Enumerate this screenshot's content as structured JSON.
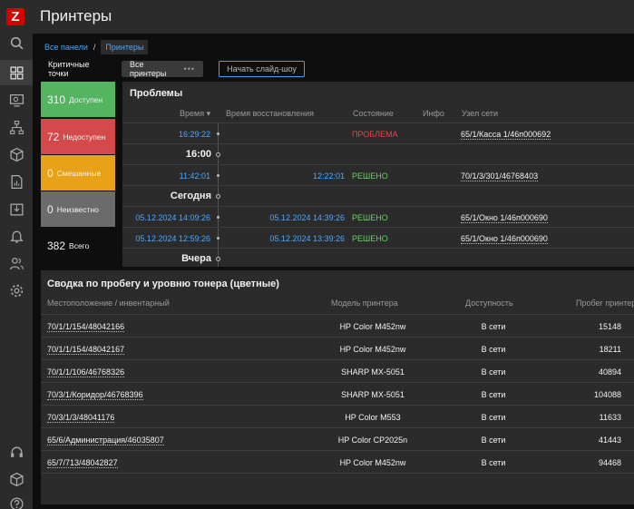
{
  "app": {
    "logo_letter": "Z"
  },
  "header": {
    "title": "Принтеры"
  },
  "breadcrumb": {
    "all": "Все панели",
    "separator": "/",
    "current": "Принтеры"
  },
  "tabs": {
    "critical": "Критичные точки",
    "all": "Все принтеры",
    "all_more": "•••"
  },
  "slideshow": {
    "label": "Начать слайд-шоу"
  },
  "sidebar": {
    "icons": [
      "search-icon",
      "dashboard-icon",
      "monitoring-icon",
      "network-icon",
      "inventory-icon",
      "reports-icon",
      "data-collection-icon",
      "alerts-icon",
      "users-icon",
      "settings-icon",
      "support-icon",
      "integrations-icon",
      "help-icon"
    ]
  },
  "status": {
    "available": {
      "count": "310",
      "label": "Доступен",
      "color": "#53b560"
    },
    "unavailable": {
      "count": "72",
      "label": "Недоступен",
      "color": "#d44a4a"
    },
    "mixed": {
      "count": "0",
      "label": "Смешанные",
      "color": "#e8a219"
    },
    "unknown": {
      "count": "0",
      "label": "Неизвестно",
      "color": "#6b6b6b"
    },
    "total": {
      "count": "382",
      "label": "Всего"
    }
  },
  "problems": {
    "title": "Проблемы",
    "columns": {
      "time": "Время ▾",
      "recovery": "Время восстановления",
      "state": "Состояние",
      "info": "Инфо",
      "host": "Узел сети"
    },
    "rows": [
      {
        "type": "event",
        "time": "16:29:22",
        "recovery": "",
        "state": "ПРОБЛЕМА",
        "host": "65/1/Касса 1/46п000692"
      },
      {
        "type": "divider",
        "label": "16:00"
      },
      {
        "type": "event",
        "time": "11:42:01",
        "recovery": "12:22:01",
        "state": "РЕШЕНО",
        "host": "70/1/3/301/46768403"
      },
      {
        "type": "divider",
        "label": "Сегодня"
      },
      {
        "type": "event",
        "time": "05.12.2024 14:09:26",
        "recovery": "05.12.2024 14:39:26",
        "state": "РЕШЕНО",
        "host": "65/1/Окно 1/46п000690"
      },
      {
        "type": "event",
        "time": "05.12.2024 12:59:26",
        "recovery": "05.12.2024 13:39:26",
        "state": "РЕШЕНО",
        "host": "65/1/Окно 1/46п000690"
      },
      {
        "type": "divider",
        "label": "Вчера"
      }
    ]
  },
  "summary": {
    "title": "Сводка по пробегу и уровню тонера (цветные)",
    "columns": {
      "location": "Местоположение / инвентарный",
      "model": "Модель принтера",
      "availability": "Доступность",
      "mileage": "Пробег принтера"
    },
    "rows": [
      {
        "location": "70/1/1/154/48042166",
        "model": "HP Color M452nw",
        "availability": "В сети",
        "mileage": "15148"
      },
      {
        "location": "70/1/1/154/48042167",
        "model": "HP Color M452nw",
        "availability": "В сети",
        "mileage": "18211"
      },
      {
        "location": "70/1/1/106/46768326",
        "model": "SHARP MX-5051",
        "availability": "В сети",
        "mileage": "40894"
      },
      {
        "location": "70/3/1/Коридор/46768396",
        "model": "SHARP MX-5051",
        "availability": "В сети",
        "mileage": "104088"
      },
      {
        "location": "70/3/1/3/48041176",
        "model": "HP Color M553",
        "availability": "В сети",
        "mileage": "11633"
      },
      {
        "location": "65/6/Администрация/46035807",
        "model": "HP Color CP2025n",
        "availability": "В сети",
        "mileage": "41443"
      },
      {
        "location": "65/7/713/48042827",
        "model": "HP Color M452nw",
        "availability": "В сети",
        "mileage": "94468"
      }
    ]
  }
}
